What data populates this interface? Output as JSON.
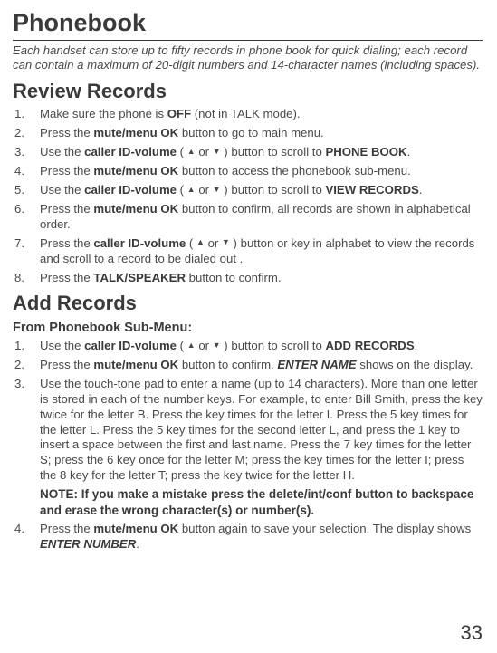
{
  "title": "Phonebook",
  "intro": "Each handset can store up to fifty records in phone book for quick dialing; each record can contain a maximum of 20-digit numbers and 14-character names (including spaces).",
  "review": {
    "heading": "Review Records",
    "items": [
      {
        "pre": "Make sure the phone is ",
        "b1": "OFF",
        "post": " (not in TALK mode)."
      },
      {
        "pre": "Press the ",
        "b1": "mute/menu OK",
        "post": " button to go to main menu."
      },
      {
        "pre": "Use the ",
        "b1": "caller ID-volume",
        "mid": " ( ",
        "up": "▲",
        "or": "  or  ",
        "down": "▼",
        "mid2": " ) button to scroll to ",
        "b2": "PHONE BOOK",
        "post": "."
      },
      {
        "pre": "Press the ",
        "b1": "mute/menu OK",
        "post": " button to access the phonebook sub-menu."
      },
      {
        "pre": "Use the ",
        "b1": "caller ID-volume",
        "mid": " ( ",
        "up": "▲",
        "or": "  or  ",
        "down": "▼",
        "mid2": " ) button to scroll to ",
        "b2": "VIEW RECORDS",
        "post": "."
      },
      {
        "pre": "Press the ",
        "b1": "mute/menu OK",
        "post": " button to confirm, all records are shown in alphabetical order."
      },
      {
        "pre": "Press the ",
        "b1": "caller ID-volume",
        "mid": " ( ",
        "up": "▲",
        "or": "  or  ",
        "down": "▼",
        "mid2": " ) button or key in alphabet to view the records and scroll to a record to be dialed out ."
      },
      {
        "pre": "Press the ",
        "b1": "TALK/SPEAKER",
        "post": " button to confirm."
      }
    ]
  },
  "add": {
    "heading": "Add Records",
    "subheading": "From Phonebook Sub-Menu:",
    "items": [
      {
        "pre": "Use the ",
        "b1": "caller ID-volume",
        "mid": " ( ",
        "up": "▲",
        "or": "  or  ",
        "down": "▼",
        "mid2": " ) button to scroll to ",
        "b2": "ADD RECORDS",
        "post": "."
      },
      {
        "pre": "Press the ",
        "b1": "mute/menu OK",
        "post1": " button to confirm. ",
        "bi": "ENTER NAME",
        "post2": " shows on the display."
      },
      {
        "text": "Use the touch-tone pad to enter a name (up to 14 characters). More than one letter is stored in each of the number keys. For example, to enter Bill Smith, press the key twice for the letter B. Press the key times for the letter I. Press the 5 key times for the letter L. Press the 5 key times for the second letter L, and press the 1 key to insert a space between the first and last name. Press the 7 key times for the letter S; press the 6 key once for the letter M; press the key times for the letter I; press the 8 key for the letter T; press the key twice for the letter H.",
        "note": "NOTE: If you make a mistake press the delete/int/conf button to backspace and erase the wrong character(s) or number(s)."
      },
      {
        "pre": "Press the ",
        "b1": "mute/menu OK",
        "post1": " button again to save your selection. The display shows ",
        "bi": "ENTER NUMBER",
        "post2": "."
      }
    ]
  },
  "page": "33"
}
